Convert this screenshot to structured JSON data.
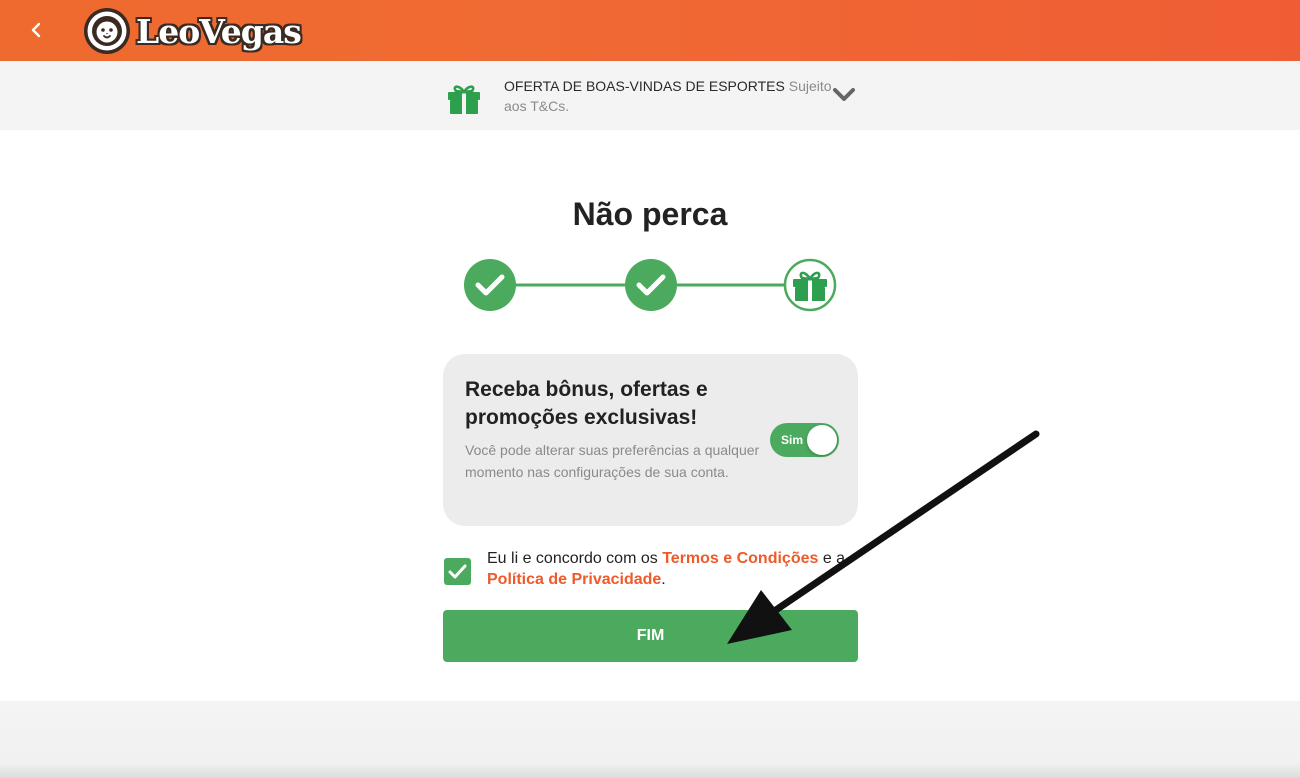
{
  "header": {
    "logo_text": "LeoVegas",
    "brand_color": "#ef6430"
  },
  "offer": {
    "title": "OFERTA DE BOAS-VINDAS DE ESPORTES",
    "subtitle": "Sujeito aos T&Cs."
  },
  "main": {
    "title": "Não perca",
    "steps": [
      {
        "state": "complete",
        "icon": "check-icon"
      },
      {
        "state": "complete",
        "icon": "check-icon"
      },
      {
        "state": "current",
        "icon": "gift-icon"
      }
    ],
    "card": {
      "heading": "Receba bônus, ofertas e promoções exclusivas!",
      "description": "Você pode alterar suas preferências a qualquer momento nas configurações de sua conta.",
      "toggle_label": "Sim",
      "toggle_on": true
    },
    "consent": {
      "checked": true,
      "text_before": "Eu li e concordo com os ",
      "terms_link": "Termos e Condições",
      "text_middle": " e a ",
      "privacy_link": "Política de Privacidade",
      "text_after": "."
    },
    "submit_label": "FIM"
  },
  "colors": {
    "accent_green": "#4caa5e",
    "link_orange": "#ee5a2a"
  }
}
